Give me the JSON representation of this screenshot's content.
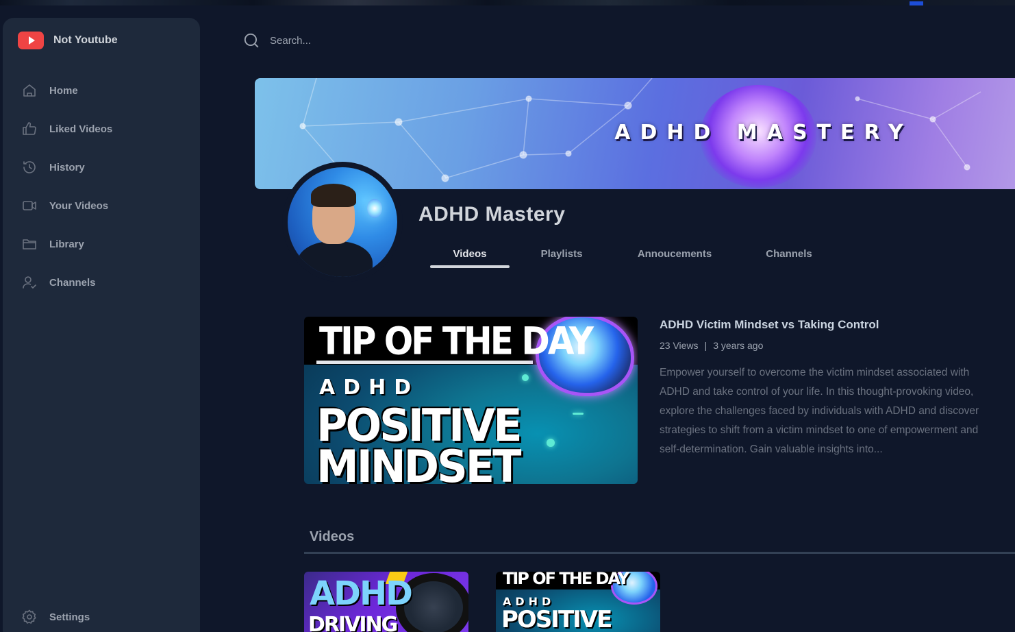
{
  "app": {
    "name": "Not Youtube"
  },
  "sidebar": {
    "items": [
      {
        "label": "Home",
        "icon": "home-icon"
      },
      {
        "label": "Liked Videos",
        "icon": "thumbs-up-icon"
      },
      {
        "label": "History",
        "icon": "history-icon"
      },
      {
        "label": "Your Videos",
        "icon": "video-camera-icon"
      },
      {
        "label": "Library",
        "icon": "folder-icon"
      },
      {
        "label": "Channels",
        "icon": "user-check-icon"
      }
    ],
    "settings": {
      "label": "Settings",
      "icon": "gear-icon"
    }
  },
  "search": {
    "placeholder": "Search...",
    "value": ""
  },
  "banner": {
    "title": "ADHD MASTERY"
  },
  "channel": {
    "name": "ADHD Mastery",
    "tabs": [
      {
        "label": "Videos",
        "active": true
      },
      {
        "label": "Playlists",
        "active": false
      },
      {
        "label": "Annoucements",
        "active": false
      },
      {
        "label": "Channels",
        "active": false
      }
    ]
  },
  "featured": {
    "title": "ADHD Victim Mindset vs Taking Control",
    "views": "23 Views",
    "separator": "|",
    "age": "3 years ago",
    "description": "Empower yourself to overcome the victim mindset associated with ADHD and take control of your life. In this thought-provoking video, explore the challenges faced by individuals with ADHD and discover strategies to shift from a victim mindset to one of empowerment and self-determination. Gain valuable insights into...",
    "thumbnail": {
      "line1": "TIP OF THE DAY",
      "line2": "ADHD",
      "line3": "POSITIVE",
      "line4": "MINDSET"
    }
  },
  "videos_section": {
    "title": "Videos",
    "thumbnails": [
      {
        "line1": "ADHD",
        "line2": "DRIVING ADVICE"
      },
      {
        "line1": "TIP OF THE DAY",
        "line2": "ADHD",
        "line3": "POSITIVE"
      }
    ]
  },
  "colors": {
    "background": "#0f172a",
    "sidebar": "#1e293b",
    "brand_red": "#ef4444",
    "text_primary": "#d1d5db",
    "text_muted": "#9ca3af"
  }
}
